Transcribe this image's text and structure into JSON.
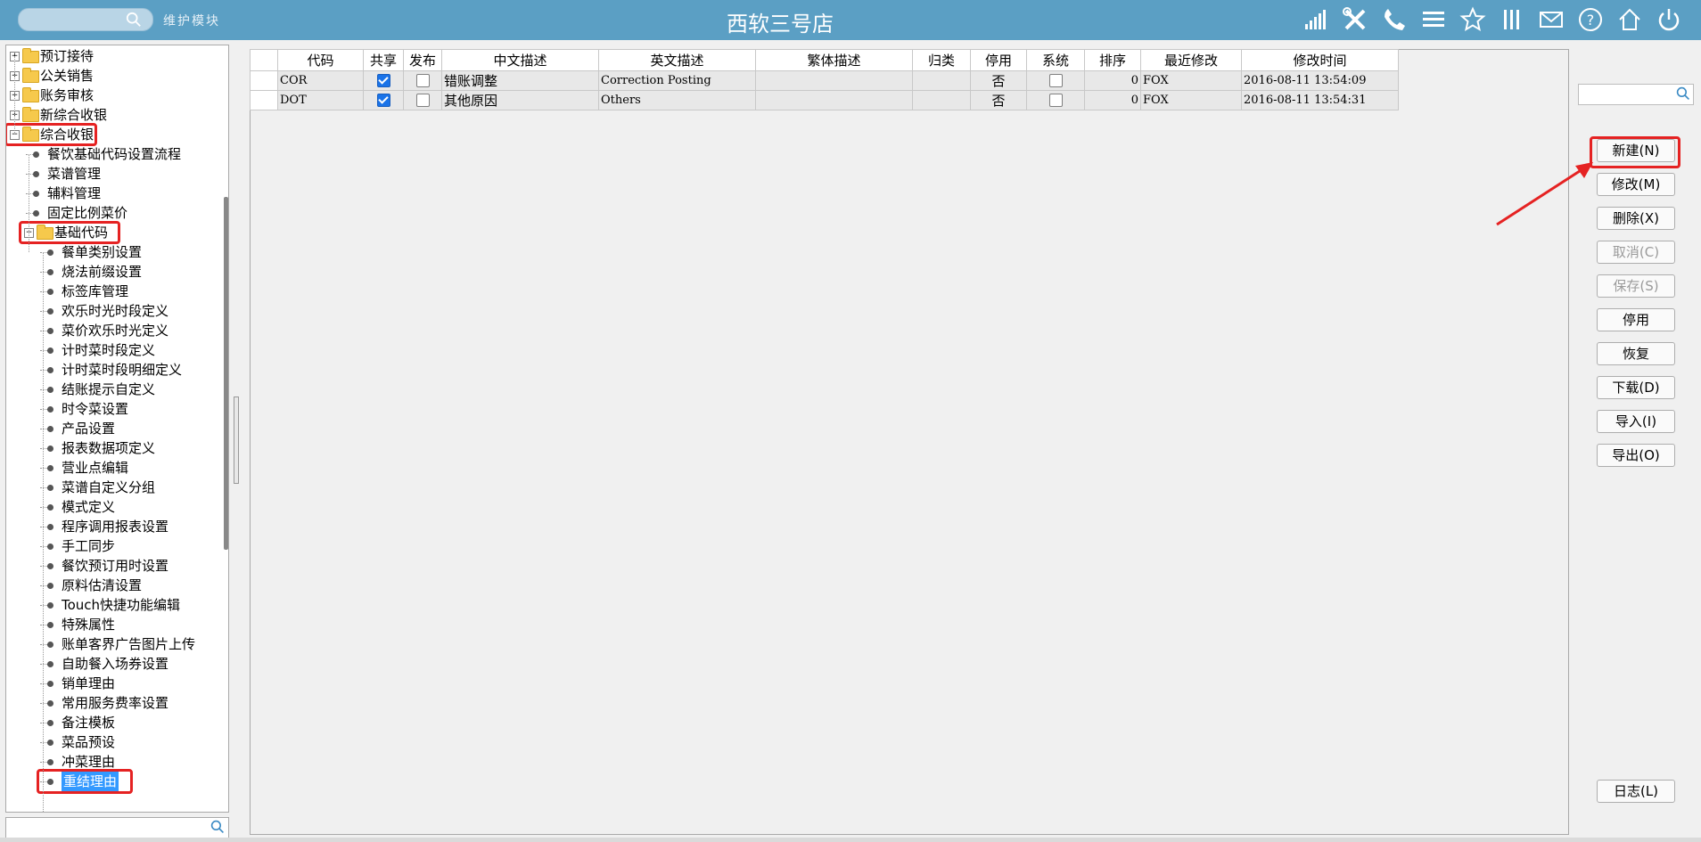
{
  "header": {
    "search_placeholder": "",
    "module_label": "维护模块",
    "title": "西软三号店",
    "icons": [
      "signal-icon",
      "tools-icon",
      "phone-icon",
      "menu-icon",
      "star-icon",
      "columns-icon",
      "mail-icon",
      "help-icon",
      "home-icon",
      "power-icon"
    ]
  },
  "tree": {
    "nodes": [
      {
        "label": "预订接待",
        "level": 0,
        "type": "folder",
        "expander": "+"
      },
      {
        "label": "公关销售",
        "level": 0,
        "type": "folder",
        "expander": "+"
      },
      {
        "label": "账务审核",
        "level": 0,
        "type": "folder",
        "expander": "+"
      },
      {
        "label": "新综合收银",
        "level": 0,
        "type": "folder",
        "expander": "+"
      },
      {
        "label": "综合收银",
        "level": 0,
        "type": "folder",
        "expander": "-",
        "highlighted": true
      },
      {
        "label": "餐饮基础代码设置流程",
        "level": 1,
        "type": "leaf"
      },
      {
        "label": "菜谱管理",
        "level": 1,
        "type": "leaf"
      },
      {
        "label": "辅料管理",
        "level": 1,
        "type": "leaf"
      },
      {
        "label": "固定比例菜价",
        "level": 1,
        "type": "leaf"
      },
      {
        "label": "基础代码",
        "level": 1,
        "type": "folder",
        "expander": "-",
        "highlighted": true
      },
      {
        "label": "餐单类别设置",
        "level": 2,
        "type": "leaf"
      },
      {
        "label": "烧法前缀设置",
        "level": 2,
        "type": "leaf"
      },
      {
        "label": "标签库管理",
        "level": 2,
        "type": "leaf"
      },
      {
        "label": "欢乐时光时段定义",
        "level": 2,
        "type": "leaf"
      },
      {
        "label": "菜价欢乐时光定义",
        "level": 2,
        "type": "leaf"
      },
      {
        "label": "计时菜时段定义",
        "level": 2,
        "type": "leaf"
      },
      {
        "label": "计时菜时段明细定义",
        "level": 2,
        "type": "leaf"
      },
      {
        "label": "结账提示自定义",
        "level": 2,
        "type": "leaf"
      },
      {
        "label": "时令菜设置",
        "level": 2,
        "type": "leaf"
      },
      {
        "label": "产品设置",
        "level": 2,
        "type": "leaf"
      },
      {
        "label": "报表数据项定义",
        "level": 2,
        "type": "leaf"
      },
      {
        "label": "营业点编辑",
        "level": 2,
        "type": "leaf"
      },
      {
        "label": "菜谱自定义分组",
        "level": 2,
        "type": "leaf"
      },
      {
        "label": "模式定义",
        "level": 2,
        "type": "leaf"
      },
      {
        "label": "程序调用报表设置",
        "level": 2,
        "type": "leaf"
      },
      {
        "label": "手工同步",
        "level": 2,
        "type": "leaf"
      },
      {
        "label": "餐饮预订用时设置",
        "level": 2,
        "type": "leaf"
      },
      {
        "label": "原料估清设置",
        "level": 2,
        "type": "leaf"
      },
      {
        "label": "Touch快捷功能编辑",
        "level": 2,
        "type": "leaf"
      },
      {
        "label": "特殊属性",
        "level": 2,
        "type": "leaf"
      },
      {
        "label": "账单客界广告图片上传",
        "level": 2,
        "type": "leaf"
      },
      {
        "label": "自助餐入场券设置",
        "level": 2,
        "type": "leaf"
      },
      {
        "label": "销单理由",
        "level": 2,
        "type": "leaf"
      },
      {
        "label": "常用服务费率设置",
        "level": 2,
        "type": "leaf"
      },
      {
        "label": "备注模板",
        "level": 2,
        "type": "leaf"
      },
      {
        "label": "菜品预设",
        "level": 2,
        "type": "leaf"
      },
      {
        "label": "冲菜理由",
        "level": 2,
        "type": "leaf"
      },
      {
        "label": "重结理由",
        "level": 2,
        "type": "leaf",
        "selected": true,
        "highlighted": true
      }
    ],
    "search_placeholder": ""
  },
  "grid": {
    "columns": [
      "代码",
      "共享",
      "发布",
      "中文描述",
      "英文描述",
      "繁体描述",
      "归类",
      "停用",
      "系统",
      "排序",
      "最近修改",
      "修改时间"
    ],
    "rows": [
      {
        "code": "COR",
        "shared": true,
        "published": false,
        "cn": "错账调整",
        "en": "Correction Posting",
        "tw": "",
        "category": "",
        "disabled": "否",
        "system": false,
        "sort": "0",
        "modifier": "FOX",
        "modified": "2016-08-11 13:54:09"
      },
      {
        "code": "DOT",
        "shared": true,
        "published": false,
        "cn": "其他原因",
        "en": "Others",
        "tw": "",
        "category": "",
        "disabled": "否",
        "system": false,
        "sort": "0",
        "modifier": "FOX",
        "modified": "2016-08-11 13:54:31"
      }
    ]
  },
  "actions": {
    "new": "新建(N)",
    "edit": "修改(M)",
    "delete": "删除(X)",
    "cancel": "取消(C)",
    "save": "保存(S)",
    "disable": "停用",
    "restore": "恢复",
    "download": "下载(D)",
    "import": "导入(I)",
    "export": "导出(O)",
    "log": "日志(L)"
  },
  "colors": {
    "header_bg": "#5b9fc4",
    "highlight_red": "#e52222",
    "selection_blue": "#3399ff"
  }
}
